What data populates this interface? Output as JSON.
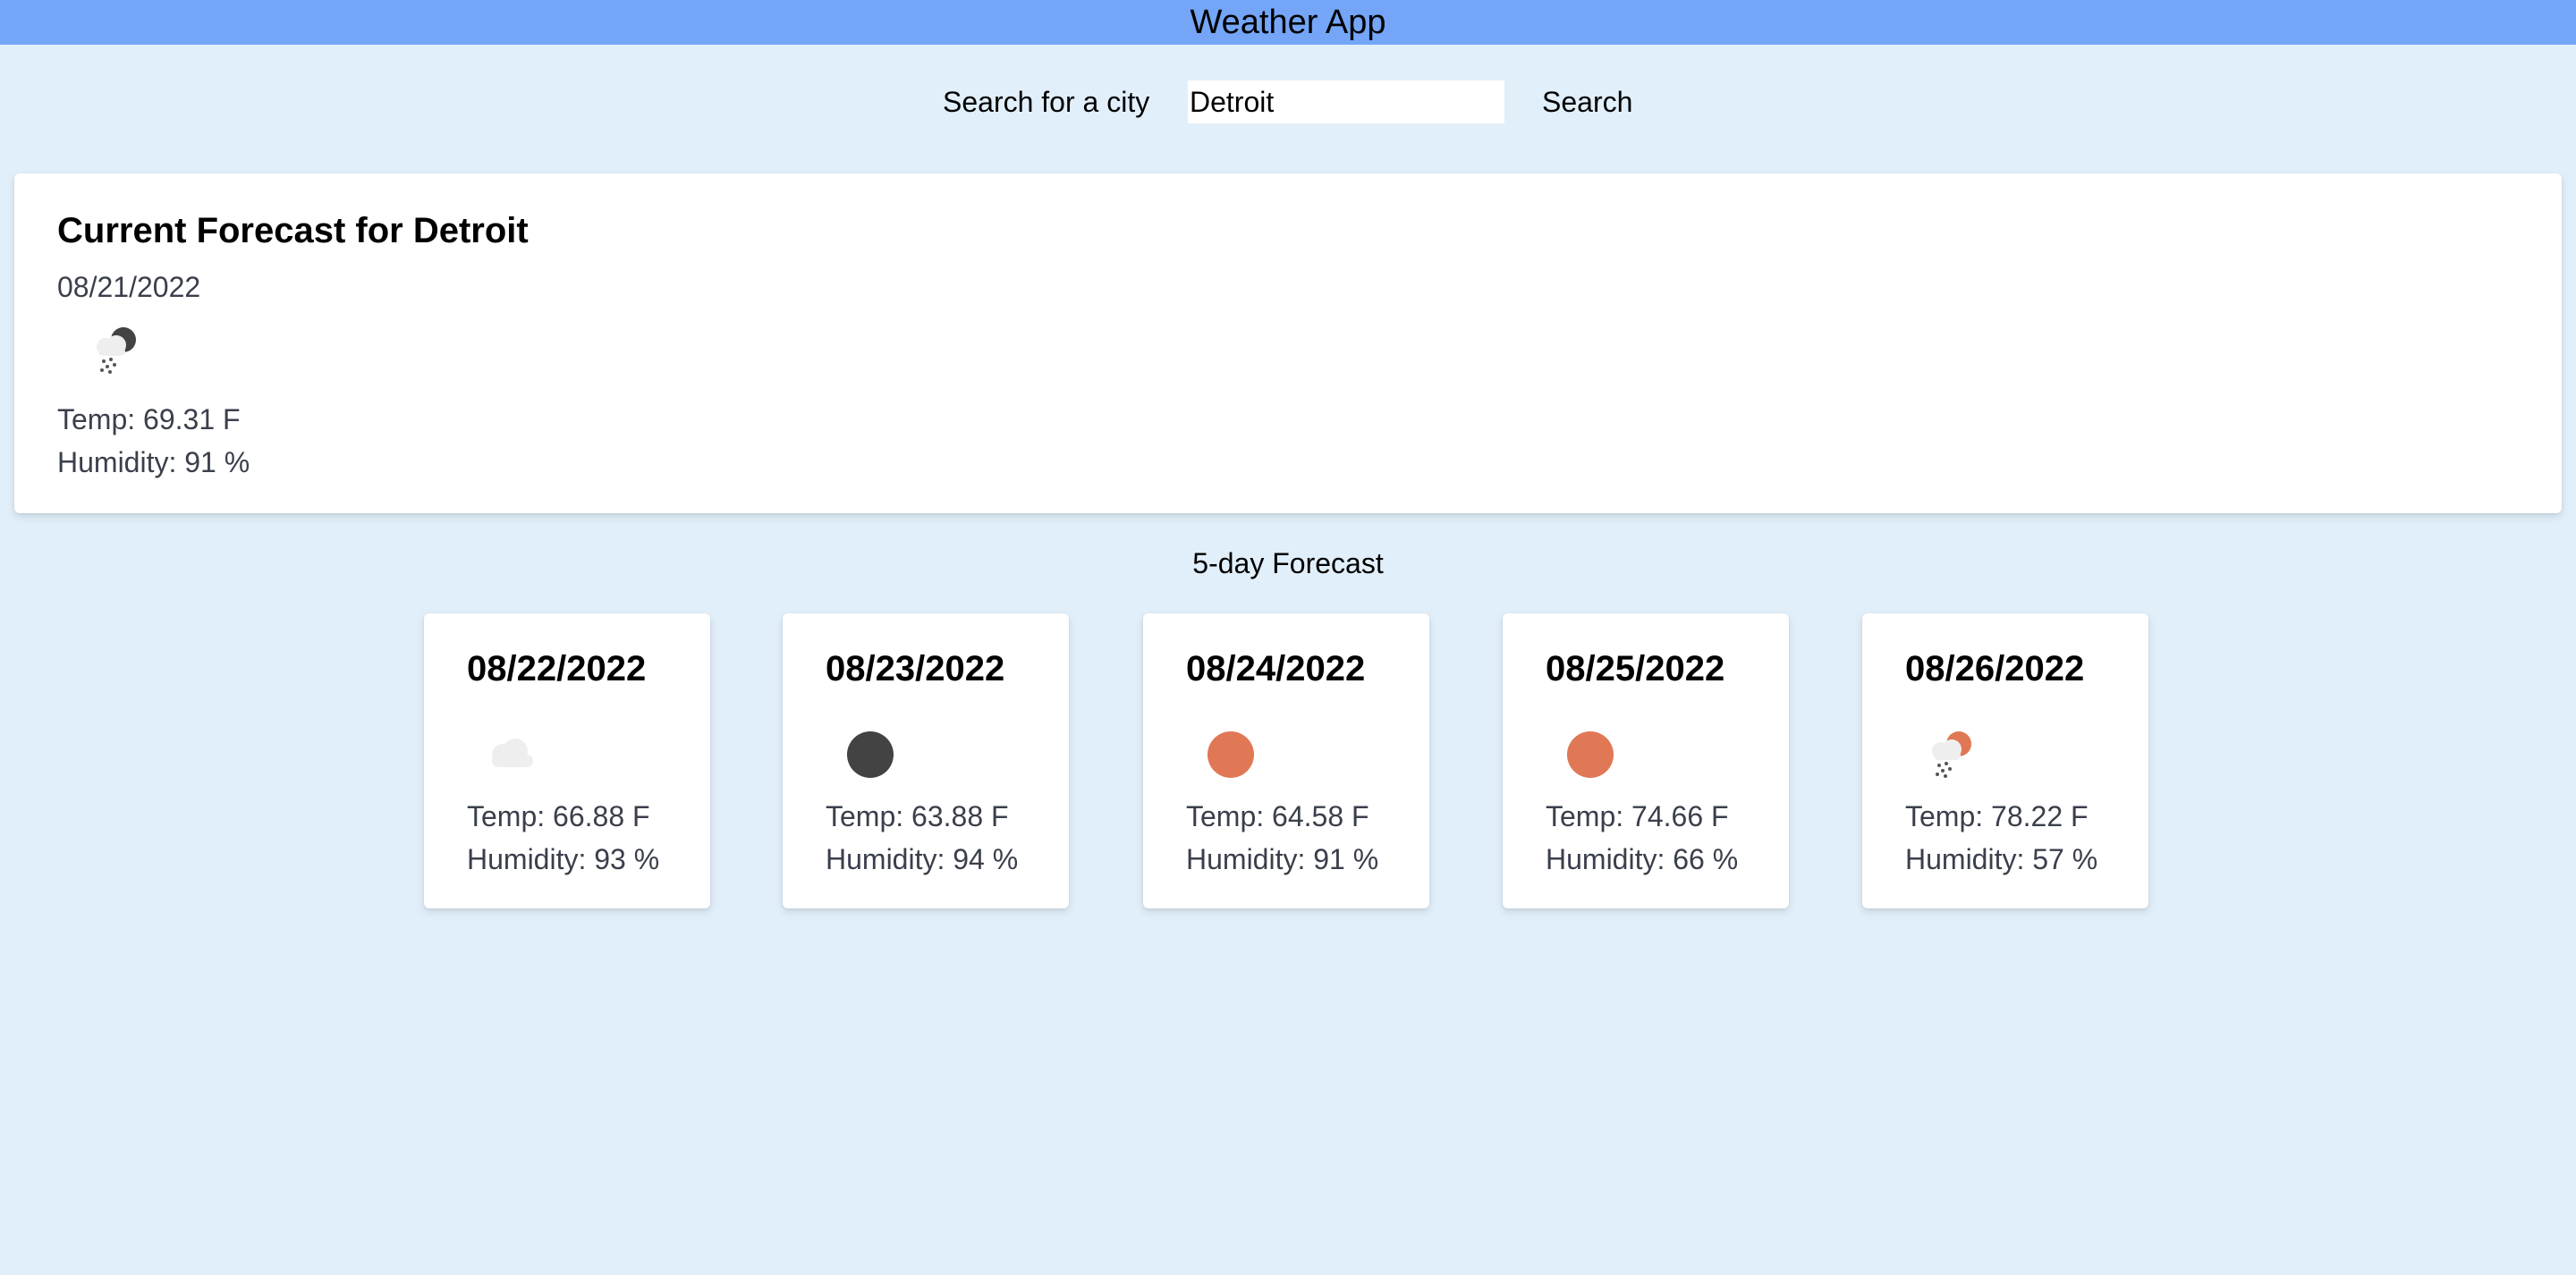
{
  "header": {
    "title": "Weather App"
  },
  "search": {
    "label": "Search for a city",
    "value": "Detroit",
    "placeholder": "",
    "button_label": "Search"
  },
  "current": {
    "title": "Current Forecast for Detroit",
    "date": "08/21/2022",
    "icon": "snow-night-icon",
    "temp": "Temp: 69.31 F",
    "humidity": "Humidity: 91 %"
  },
  "forecast": {
    "heading": "5-day Forecast",
    "days": [
      {
        "date": "08/22/2022",
        "icon": "cloud-icon",
        "temp": "Temp: 66.88 F",
        "humidity": "Humidity: 93 %"
      },
      {
        "date": "08/23/2022",
        "icon": "moon-icon",
        "temp": "Temp: 63.88 F",
        "humidity": "Humidity: 94 %"
      },
      {
        "date": "08/24/2022",
        "icon": "sun-icon",
        "temp": "Temp: 64.58 F",
        "humidity": "Humidity: 91 %"
      },
      {
        "date": "08/25/2022",
        "icon": "sun-icon",
        "temp": "Temp: 74.66 F",
        "humidity": "Humidity: 66 %"
      },
      {
        "date": "08/26/2022",
        "icon": "snow-day-icon",
        "temp": "Temp: 78.22 F",
        "humidity": "Humidity: 57 %"
      }
    ]
  },
  "colors": {
    "background": "#e1effa",
    "header": "#74a5f7",
    "card": "#ffffff",
    "sun": "#e07856",
    "moon": "#434343",
    "cloud": "#eeeeee"
  }
}
